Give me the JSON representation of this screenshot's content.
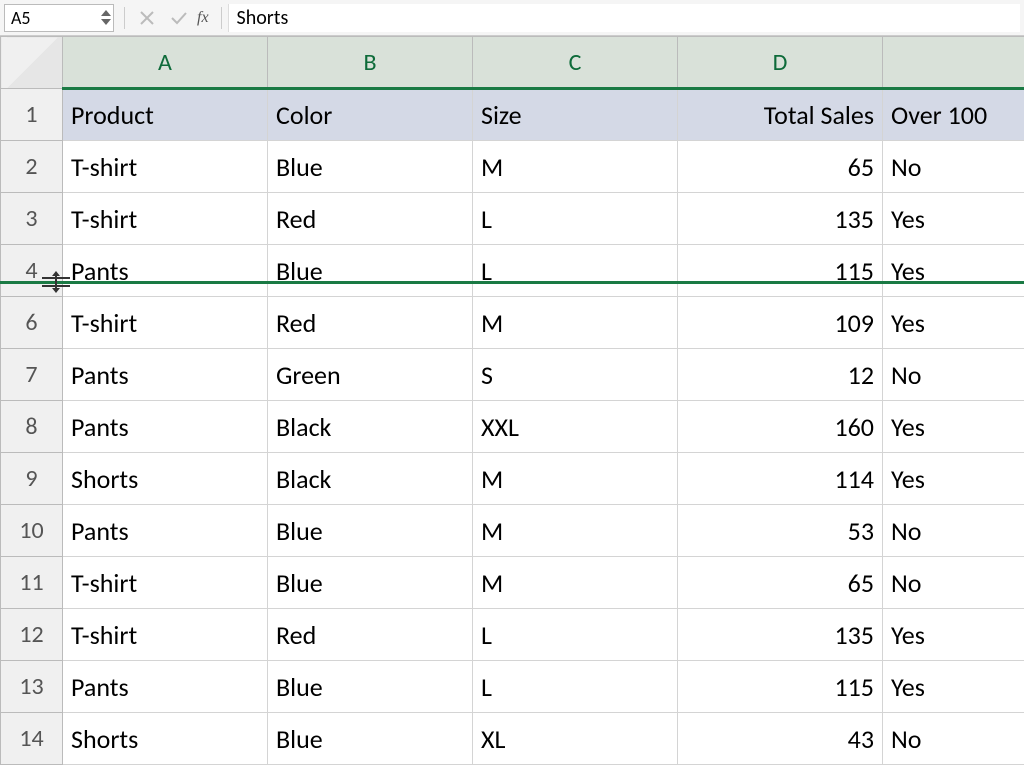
{
  "formula_bar": {
    "cell_ref": "A5",
    "fx_label": "fx",
    "value": "Shorts"
  },
  "columns": [
    "A",
    "B",
    "C",
    "D",
    ""
  ],
  "rows": [
    "1",
    "2",
    "3",
    "4",
    "6",
    "7",
    "8",
    "9",
    "10",
    "11",
    "12",
    "13",
    "14"
  ],
  "headers": {
    "A": "Product",
    "B": "Color",
    "C": "Size",
    "D": "Total Sales",
    "E": "Over 100"
  },
  "data": [
    {
      "n": "2",
      "A": "T-shirt",
      "B": "Blue",
      "C": "M",
      "D": 65,
      "E": "No"
    },
    {
      "n": "3",
      "A": "T-shirt",
      "B": "Red",
      "C": "L",
      "D": 135,
      "E": "Yes"
    },
    {
      "n": "4",
      "A": "Pants",
      "B": "Blue",
      "C": "L",
      "D": 115,
      "E": "Yes"
    },
    {
      "n": "6",
      "A": "T-shirt",
      "B": "Red",
      "C": "M",
      "D": 109,
      "E": "Yes"
    },
    {
      "n": "7",
      "A": "Pants",
      "B": "Green",
      "C": "S",
      "D": 12,
      "E": "No"
    },
    {
      "n": "8",
      "A": "Pants",
      "B": "Black",
      "C": "XXL",
      "D": 160,
      "E": "Yes"
    },
    {
      "n": "9",
      "A": "Shorts",
      "B": "Black",
      "C": "M",
      "D": 114,
      "E": "Yes"
    },
    {
      "n": "10",
      "A": "Pants",
      "B": "Blue",
      "C": "M",
      "D": 53,
      "E": "No"
    },
    {
      "n": "11",
      "A": "T-shirt",
      "B": "Blue",
      "C": "M",
      "D": 65,
      "E": "No"
    },
    {
      "n": "12",
      "A": "T-shirt",
      "B": "Red",
      "C": "L",
      "D": 135,
      "E": "Yes"
    },
    {
      "n": "13",
      "A": "Pants",
      "B": "Blue",
      "C": "L",
      "D": 115,
      "E": "Yes"
    },
    {
      "n": "14",
      "A": "Shorts",
      "B": "Blue",
      "C": "XL",
      "D": 43,
      "E": "No"
    }
  ],
  "hidden_row_after": "4"
}
